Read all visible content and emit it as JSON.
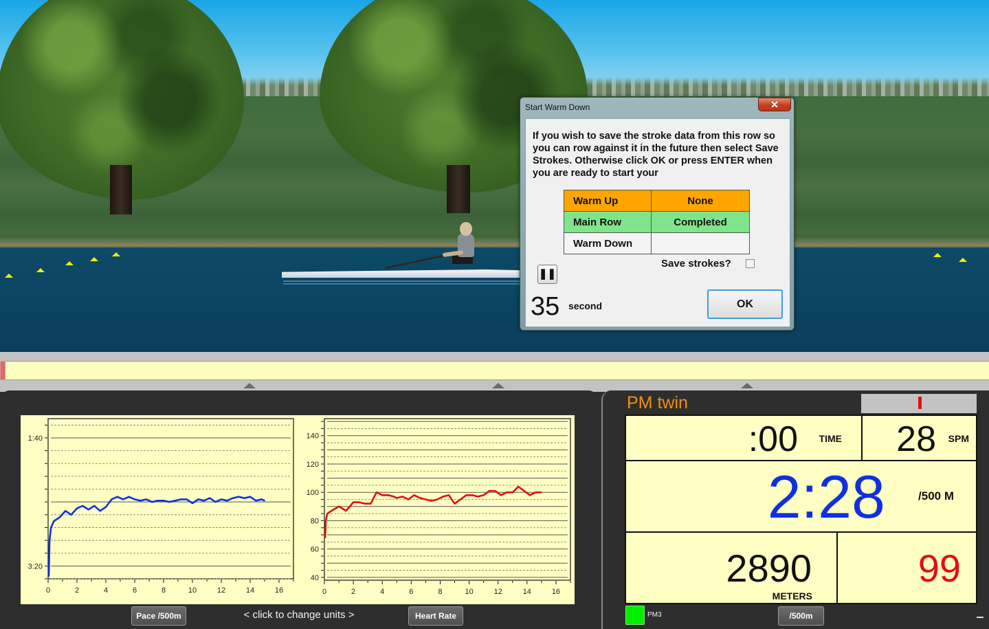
{
  "dialog": {
    "title": "Start Warm Down",
    "close_glyph": "✕",
    "message": "If you wish to save the stroke data from this row so you can row against it in the future then select Save Strokes.  Otherwise click OK or press ENTER when you are ready to start your",
    "phases": [
      {
        "name": "Warm Up",
        "status": "None",
        "color": "#ffa500"
      },
      {
        "name": "Main Row",
        "status": "Completed",
        "color": "#80e58a"
      },
      {
        "name": "Warm Down",
        "status": "",
        "color": "#f4f4f4"
      }
    ],
    "save_strokes_label": "Save strokes?",
    "save_strokes_checked": false,
    "pause_glyph": "❚❚",
    "countdown_value": "35",
    "countdown_unit": "second",
    "ok_label": "OK"
  },
  "charts": {
    "pace_button": "Pace /500m",
    "units_hint": "<  click to change units  >",
    "heart_rate_button": "Heart Rate"
  },
  "chart_data": [
    {
      "type": "line",
      "title": "Pace /500m",
      "xlabel": "",
      "ylabel": "",
      "x_ticks": [
        "0",
        "2",
        "4",
        "6",
        "8",
        "10",
        "12",
        "14",
        "16"
      ],
      "y_ticks": [
        "1:40",
        "3:20"
      ],
      "xlim": [
        0,
        17
      ],
      "ylim_seconds": [
        85,
        210
      ],
      "y_inverted": true,
      "grid": true,
      "color": "#1030e0",
      "series": [
        {
          "name": "Pace",
          "x": [
            0.05,
            0.1,
            0.2,
            0.4,
            0.8,
            1.2,
            1.6,
            2.0,
            2.4,
            2.8,
            3.2,
            3.6,
            4.0,
            4.4,
            4.8,
            5.2,
            5.6,
            6.0,
            6.4,
            6.8,
            7.2,
            7.6,
            8.0,
            8.4,
            8.8,
            9.2,
            9.6,
            10.0,
            10.4,
            10.8,
            11.2,
            11.6,
            12.0,
            12.4,
            12.8,
            13.2,
            13.6,
            14.0,
            14.4,
            14.8,
            15.0
          ],
          "y_seconds": [
            208,
            180,
            170,
            165,
            162,
            157,
            160,
            155,
            153,
            156,
            153,
            157,
            154,
            148,
            146,
            148,
            146,
            148,
            149,
            148,
            150,
            149,
            149,
            150,
            149,
            148,
            148,
            151,
            148,
            149,
            147,
            150,
            148,
            149,
            147,
            146,
            147,
            146,
            149,
            148,
            149
          ]
        }
      ]
    },
    {
      "type": "line",
      "title": "Heart Rate",
      "xlabel": "",
      "ylabel": "",
      "x_ticks": [
        "0",
        "2",
        "4",
        "6",
        "8",
        "10",
        "12",
        "14",
        "16"
      ],
      "y_ticks": [
        "40",
        "60",
        "80",
        "100",
        "120",
        "140"
      ],
      "xlim": [
        0,
        17
      ],
      "ylim": [
        38,
        152
      ],
      "grid": true,
      "color": "#e01010",
      "series": [
        {
          "name": "Heart Rate",
          "x": [
            0.05,
            0.1,
            0.2,
            0.5,
            1.0,
            1.5,
            2.0,
            2.4,
            2.8,
            3.2,
            3.6,
            4.0,
            4.4,
            4.8,
            5.0,
            5.4,
            5.8,
            6.2,
            6.6,
            7.0,
            7.4,
            7.8,
            8.2,
            8.6,
            9.0,
            9.4,
            9.8,
            10.2,
            10.6,
            11.0,
            11.4,
            11.8,
            12.2,
            12.6,
            13.0,
            13.4,
            13.8,
            14.2,
            14.6,
            15.0
          ],
          "y": [
            68,
            80,
            85,
            87,
            90,
            87,
            93,
            93,
            92,
            92,
            100,
            98,
            98,
            97,
            96,
            97,
            95,
            98,
            96,
            95,
            94,
            95,
            97,
            98,
            92,
            95,
            98,
            98,
            97,
            98,
            101,
            101,
            98,
            100,
            100,
            104,
            101,
            98,
            100,
            100
          ]
        }
      ]
    }
  ],
  "monitor": {
    "title": "PM twin",
    "time_value": ":00",
    "time_unit": "TIME",
    "spm_value": "28",
    "spm_unit": "SPM",
    "pace_value": "2:28",
    "pace_unit": "/500 M",
    "meters_value": "2890",
    "meters_unit": "METERS",
    "heart_rate_value": "99",
    "device_label": "PM3",
    "units_button": "/500m",
    "colors": {
      "title": "#f0900f",
      "pace": "#1030e0",
      "heart_rate": "#e01010",
      "led": "#00f000"
    }
  }
}
